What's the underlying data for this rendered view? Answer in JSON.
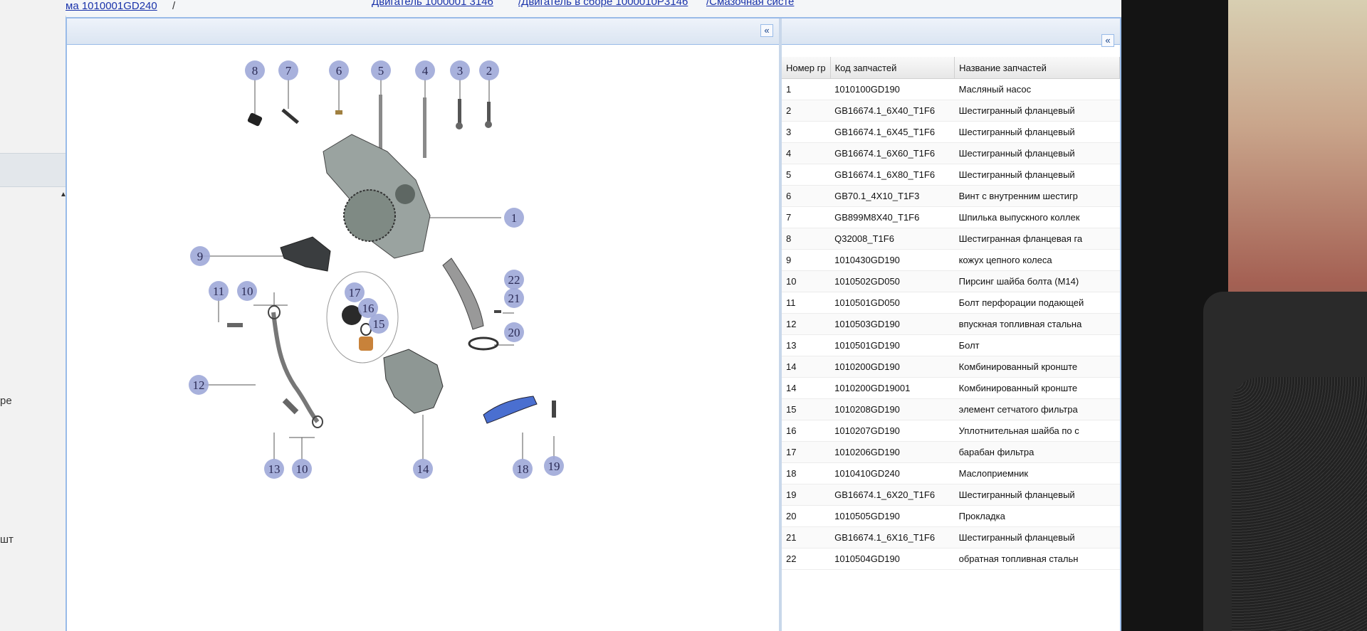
{
  "breadcrumb": {
    "crumb1": "ма 1010001GD240",
    "separator": "/",
    "crumb2": "Двигатель 1000001 3146",
    "crumb3": "/Двигатель в сборе 1000010P3146",
    "crumb4": "/Смазочная систе"
  },
  "side_fragments": {
    "a": "ре",
    "b": "шт"
  },
  "controls": {
    "collapse_glyph": "«"
  },
  "table": {
    "headers": [
      "Номер гр",
      "Код запчастей",
      "Название запчастей"
    ],
    "rows": [
      [
        "1",
        "1010100GD190",
        "Масляный насос"
      ],
      [
        "2",
        "GB16674.1_6X40_T1F6",
        "Шестигранный фланцевый"
      ],
      [
        "3",
        "GB16674.1_6X45_T1F6",
        "Шестигранный фланцевый"
      ],
      [
        "4",
        "GB16674.1_6X60_T1F6",
        "Шестигранный фланцевый"
      ],
      [
        "5",
        "GB16674.1_6X80_T1F6",
        "Шестигранный фланцевый"
      ],
      [
        "6",
        "GB70.1_4X10_T1F3",
        "Винт с внутренним шестигр"
      ],
      [
        "7",
        "GB899M8X40_T1F6",
        "Шпилька выпускного коллек"
      ],
      [
        "8",
        "Q32008_T1F6",
        "Шестигранная фланцевая га"
      ],
      [
        "9",
        "1010430GD190",
        "кожух цепного колеса"
      ],
      [
        "10",
        "1010502GD050",
        "Пирсинг шайба болта (M14)"
      ],
      [
        "11",
        "1010501GD050",
        "Болт перфорации подающей"
      ],
      [
        "12",
        "1010503GD190",
        "впускная топливная стальна"
      ],
      [
        "13",
        "1010501GD190",
        "Болт"
      ],
      [
        "14",
        "1010200GD190",
        "Комбинированный кронште"
      ],
      [
        "14",
        "1010200GD19001",
        "Комбинированный кронште"
      ],
      [
        "15",
        "1010208GD190",
        "элемент сетчатого фильтра"
      ],
      [
        "16",
        "1010207GD190",
        "Уплотнительная шайба по с"
      ],
      [
        "17",
        "1010206GD190",
        "барабан фильтра"
      ],
      [
        "18",
        "1010410GD240",
        "Маслоприемник"
      ],
      [
        "19",
        "GB16674.1_6X20_T1F6",
        "Шестигранный фланцевый"
      ],
      [
        "20",
        "1010505GD190",
        "Прокладка"
      ],
      [
        "21",
        "GB16674.1_6X16_T1F6",
        "Шестигранный фланцевый"
      ],
      [
        "22",
        "1010504GD190",
        "обратная топливная стальн"
      ]
    ]
  },
  "callouts": [
    "8",
    "7",
    "6",
    "5",
    "4",
    "3",
    "2",
    "1",
    "9",
    "11",
    "10",
    "17",
    "16",
    "15",
    "22",
    "21",
    "20",
    "12",
    "13",
    "10",
    "14",
    "18",
    "19"
  ],
  "colors": {
    "callout_fill": "#9fa8d8",
    "callout_text": "#2b2b55",
    "header_blue": "#99bbe8",
    "link": "#1a33aa"
  }
}
